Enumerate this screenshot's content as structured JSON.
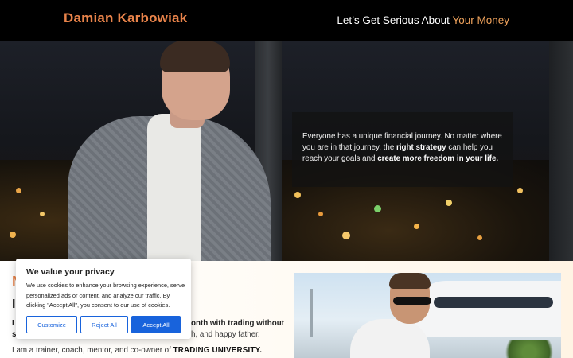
{
  "header": {
    "brand": "Damian Karbowiak",
    "tagline_prefix": "Let’s Get Serious About ",
    "tagline_accent": "Your Money"
  },
  "hero": {
    "text_1": "Everyone has a unique financial journey. No matter where you are in that journey, the ",
    "strong_1": "right strategy",
    "text_2": " can help you reach your goals and ",
    "strong_2": "create more freedom in your life."
  },
  "intro": {
    "heading_fragment_1": "N",
    "heading_fragment_2": "I",
    "line_left_1": "I",
    "line_left_2": "s",
    "line_right_1": "onth with trading without",
    "line_right_2": "h, and happy father.",
    "bio_prefix": "I am a trainer, coach, mentor, and co-owner of ",
    "bio_strong": "TRADING UNIVERSITY."
  },
  "cookie": {
    "title": "We value your privacy",
    "message": "We use cookies to enhance your browsing experience, serve personalized ads or content, and analyze our traffic. By clicking \"Accept All\", you consent to our use of cookies.",
    "customize_label": "Customize",
    "reject_label": "Reject All",
    "accept_label": "Accept All",
    "accent_color": "#1863dc"
  },
  "colors": {
    "brand": "#e8834a",
    "header_bg": "#000000",
    "tagline_accent": "#f0a35c"
  }
}
